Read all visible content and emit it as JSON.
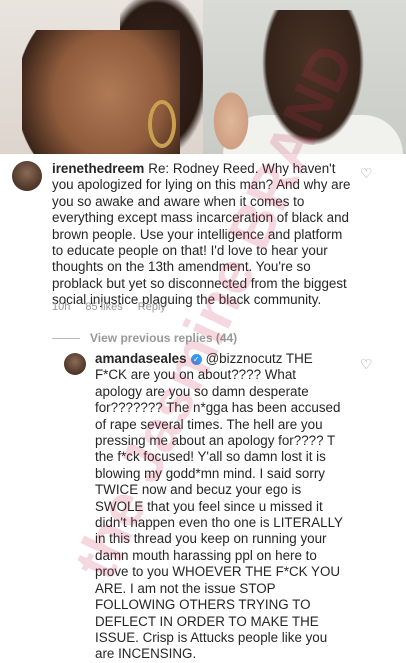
{
  "comment1": {
    "username": "irenethedreem",
    "text": "Re: Rodney Reed. Why haven't you apologized for lying on this man? And why are you so awake and aware when it comes to everything except mass incarceration of black and brown people. Use your intelligence and platform to educate people on that! I'd love to hear your thoughts on the 13th amendment. You're so problack but yet so disconnected from the biggest social injustice plaguing the black community.",
    "time": "10h",
    "likes": "85 likes",
    "reply": "Reply"
  },
  "view_previous": "View previous replies (44)",
  "comment2": {
    "username": "amandaseales",
    "verified": "✓",
    "text": "@bizznocutz THE F*CK are you on about???? What apology are you so damn desperate for??????? The n*gga has been accused of rape several times. The hell are you pressing me about an apology for???? T the f*ck focused! Y'all so damn lost it is blowing my godd*mn mind. I said sorry TWICE now and becuz your ego is SWOLE that you feel since u missed it didn't happen even tho one is LITERALLY in this thread you keep on running your damn mouth harassing ppl on here to prove to you WHOEVER THE F*CK YOU ARE. I am not the issue STOP FOLLOWING OTHERS TRYING TO DEFLECT IN ORDER TO MAKE THE ISSUE. Crisp is Attucks people like you are INCENSING."
  },
  "watermark": "the Jasmine BRAND",
  "icons": {
    "heart": "heart-icon"
  },
  "colors": {
    "meta": "#999999",
    "verified": "#3897f0"
  }
}
